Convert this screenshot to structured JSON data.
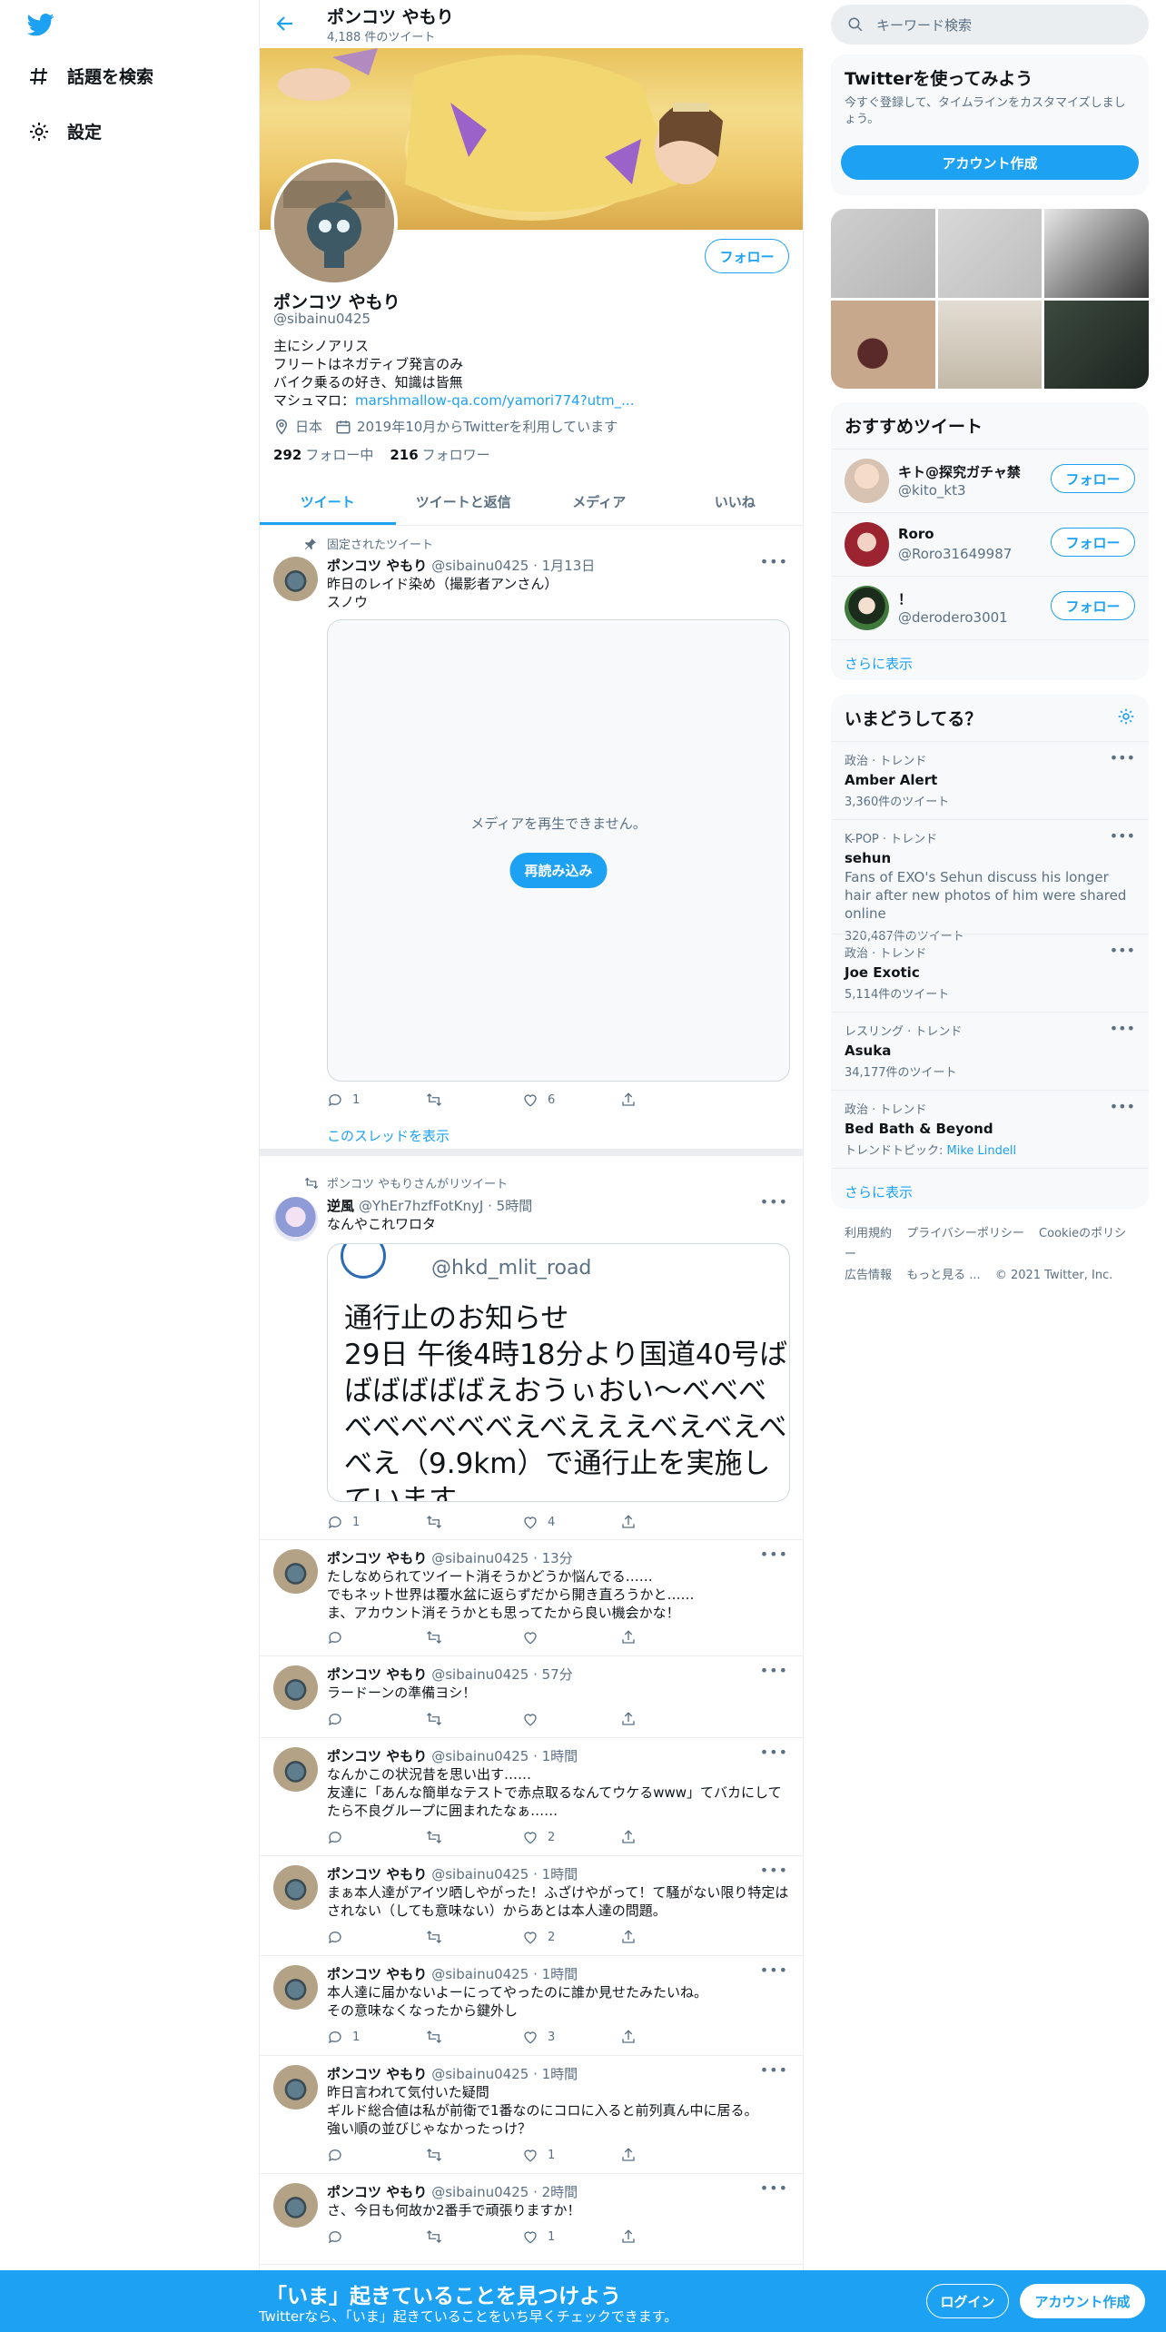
{
  "nav": {
    "explore_label": "話題を検索",
    "settings_label": "設定"
  },
  "header": {
    "title": "ポンコツ やもり",
    "subtitle": "4,188 件のツイート"
  },
  "profile": {
    "follow_label": "フォロー",
    "name": "ポンコツ やもり",
    "handle": "@sibainu0425",
    "bio_lines": [
      "主にシノアリス",
      "フリートはネガティブ発言のみ",
      "バイク乗るの好き、知識は皆無"
    ],
    "bio_link_prefix": "マシュマロ：",
    "bio_link": "marshmallow-qa.com/yamori774?utm_...",
    "location": "日本",
    "joined": "2019年10月からTwitterを利用しています",
    "following_count": "292",
    "following_label": "フォロー中",
    "followers_count": "216",
    "followers_label": "フォロワー"
  },
  "tabs": [
    {
      "label": "ツイート"
    },
    {
      "label": "ツイートと返信"
    },
    {
      "label": "メディア"
    },
    {
      "label": "いいね"
    }
  ],
  "tweets": [
    {
      "context": "固定されたツイート",
      "name": "ポンコツ やもり",
      "handle": "@sibainu0425",
      "time": "1月13日",
      "text": [
        "昨日のレイド染め（撮影者アンさん）",
        "スノウ"
      ],
      "media_error": "メディアを再生できません。",
      "reload_label": "再読み込み",
      "replies": "1",
      "retweets": "",
      "likes": "6",
      "thread_link": "このスレッドを表示"
    },
    {
      "context": "ポンコツ やもりさんがリツイート",
      "name": "逆風",
      "handle": "@YhEr7hzfFotKnyJ",
      "time": "5時間",
      "text": [
        "なんやこれワロタ"
      ],
      "quote_handle": "@hkd_mlit_road",
      "quote_lines": [
        "通行止のお知らせ",
        "29日 午後4時18分より国道40号ば",
        "ばばばばばえおうぃおい〜べべべ",
        "べべべべべべえべえええべえべえべ",
        "べえ（9.9km）で通行止を実施し",
        "ています"
      ],
      "replies": "1",
      "retweets": "",
      "likes": "4"
    },
    {
      "name": "ポンコツ やもり",
      "handle": "@sibainu0425",
      "time": "13分",
      "text": [
        "たしなめられてツイート消そうかどうか悩んでる……",
        "でもネット世界は覆水盆に返らずだから開き直ろうかと……",
        "ま、アカウント消そうかとも思ってたから良い機会かな！"
      ],
      "replies": "",
      "retweets": "",
      "likes": ""
    },
    {
      "name": "ポンコツ やもり",
      "handle": "@sibainu0425",
      "time": "57分",
      "text": [
        "ラードーンの準備ヨシ！"
      ],
      "replies": "",
      "retweets": "",
      "likes": ""
    },
    {
      "name": "ポンコツ やもり",
      "handle": "@sibainu0425",
      "time": "1時間",
      "text": [
        "なんかこの状況昔を思い出す……",
        "友達に「あんな簡単なテストで赤点取るなんてウケるwww」てバカにしてたら不良グループに囲まれたなぁ……"
      ],
      "replies": "",
      "retweets": "",
      "likes": "2"
    },
    {
      "name": "ポンコツ やもり",
      "handle": "@sibainu0425",
      "time": "1時間",
      "text": [
        "まぁ本人達がアイツ晒しやがった！ふざけやがって！て騒がない限り特定はされない（しても意味ない）からあとは本人達の問題。"
      ],
      "replies": "",
      "retweets": "",
      "likes": "2"
    },
    {
      "name": "ポンコツ やもり",
      "handle": "@sibainu0425",
      "time": "1時間",
      "text": [
        "本人達に届かないよーにってやったのに誰か見せたみたいね。",
        "その意味なくなったから鍵外し"
      ],
      "replies": "1",
      "retweets": "",
      "likes": "3"
    },
    {
      "name": "ポンコツ やもり",
      "handle": "@sibainu0425",
      "time": "1時間",
      "text": [
        "昨日言われて気付いた疑問",
        "ギルド総合値は私が前衛で1番なのにコロに入ると前列真ん中に居る。",
        "強い順の並びじゃなかったっけ？"
      ],
      "replies": "",
      "retweets": "",
      "likes": "1"
    },
    {
      "name": "ポンコツ やもり",
      "handle": "@sibainu0425",
      "time": "2時間",
      "text": [
        "さ、今日も何故か2番手で頑張りますか！"
      ],
      "replies": "",
      "retweets": "",
      "likes": "1"
    }
  ],
  "search": {
    "placeholder": "キーワード検索"
  },
  "signup_card": {
    "title": "Twitterを使ってみよう",
    "desc": "今すぐ登録して、タイムラインをカスタマイズしましょう。",
    "button": "アカウント作成"
  },
  "recommend": {
    "title": "おすすめツイート",
    "users": [
      {
        "name": "キト@探究ガチャ禁",
        "handle": "@kito_kt3",
        "follow": "フォロー"
      },
      {
        "name": "Roro",
        "handle": "@Roro31649987",
        "follow": "フォロー"
      },
      {
        "name": "！",
        "handle": "@derodero3001",
        "follow": "フォロー"
      }
    ],
    "more": "さらに表示"
  },
  "trends": {
    "title": "いまどうしてる？",
    "items": [
      {
        "context": "政治 · トレンド",
        "name": "Amber Alert",
        "desc": "",
        "count": "3,360件のツイート"
      },
      {
        "context": "K-POP · トレンド",
        "name": "sehun",
        "desc": "Fans of EXO's Sehun discuss his longer hair after new photos of him were shared online",
        "count": "320,487件のツイート"
      },
      {
        "context": "政治 · トレンド",
        "name": "Joe Exotic",
        "desc": "",
        "count": "5,114件のツイート"
      },
      {
        "context": "レスリング · トレンド",
        "name": "Asuka",
        "desc": "",
        "count": "34,177件のツイート"
      },
      {
        "context": "政治 · トレンド",
        "name": "Bed Bath & Beyond",
        "desc": "",
        "count": "トレンドトピック: ",
        "count_link": "Mike Lindell"
      }
    ],
    "more": "さらに表示"
  },
  "footer": {
    "links": [
      "利用規約",
      "プライバシーポリシー",
      "Cookieのポリシー",
      "広告情報",
      "もっと見る ..."
    ],
    "copyright": "© 2021 Twitter, Inc."
  },
  "bottom_bar": {
    "title": "「いま」起きていることを見つけよう",
    "subtitle": "Twitterなら、「いま」起きていることをいち早くチェックできます。",
    "login": "ログイン",
    "signup": "アカウント作成"
  },
  "colors": {
    "accent": "#1da1f2",
    "text": "#0f1419",
    "muted": "#5b7083",
    "border": "#ebeef0"
  }
}
